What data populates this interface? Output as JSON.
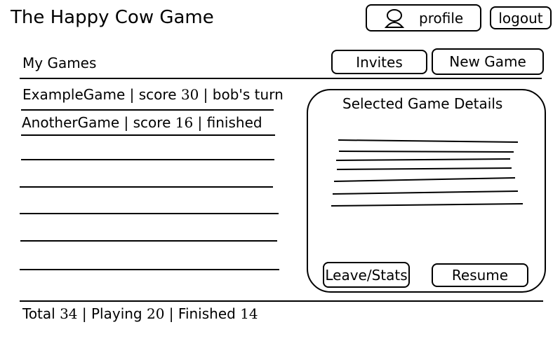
{
  "app": {
    "title": "The Happy Cow Game"
  },
  "header": {
    "profile_label": "profile",
    "profile_icon": "user-icon",
    "logout_label": "logout"
  },
  "games_section": {
    "label": "My Games",
    "invites_label": "Invites",
    "new_game_label": "New Game"
  },
  "games": [
    {
      "name": "ExampleGame",
      "score_label": "score",
      "score": "30",
      "status": "bob's turn"
    },
    {
      "name": "AnotherGame",
      "score_label": "score",
      "score": "16",
      "status": "finished"
    }
  ],
  "details": {
    "title": "Selected Game Details",
    "leave_label": "Leave/Stats",
    "resume_label": "Resume"
  },
  "footer": {
    "total_label": "Total",
    "total": "34",
    "playing_label": "Playing",
    "playing": "20",
    "finished_label": "Finished",
    "finished": "14"
  }
}
